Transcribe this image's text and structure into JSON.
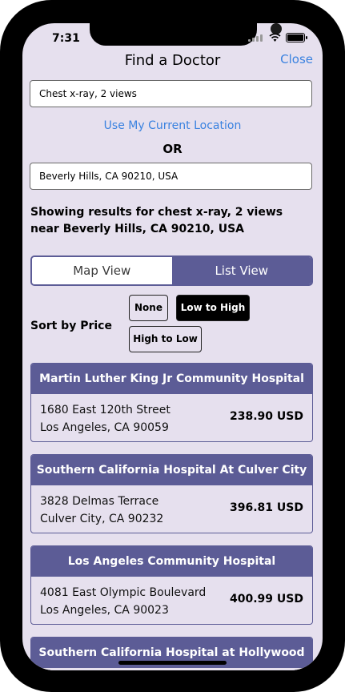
{
  "status": {
    "time": "7:31"
  },
  "header": {
    "title": "Find a Doctor",
    "close_label": "Close"
  },
  "search": {
    "procedure_value": "Chest x-ray, 2 views",
    "location_link": "Use My Current Location",
    "or_label": "OR",
    "location_value": "Beverly Hills, CA 90210, USA"
  },
  "results_text": "Showing results for chest x-ray, 2 views near Beverly Hills, CA 90210, USA",
  "view_toggle": {
    "map_label": "Map View",
    "list_label": "List View",
    "selected": "List View"
  },
  "sort": {
    "label": "Sort by Price",
    "options": [
      "None",
      "Low to High",
      "High to Low"
    ],
    "selected": "Low to High"
  },
  "hospitals": [
    {
      "name": "Martin Luther King Jr Community Hospital",
      "address1": "1680 East 120th Street",
      "address2": "Los Angeles, CA 90059",
      "price": "238.90 USD"
    },
    {
      "name": "Southern California Hospital At Culver City",
      "address1": "3828 Delmas Terrace",
      "address2": "Culver City, CA 90232",
      "price": "396.81 USD"
    },
    {
      "name": "Los Angeles Community Hospital",
      "address1": "4081 East Olympic Boulevard",
      "address2": "Los Angeles, CA 90023",
      "price": "400.99 USD"
    },
    {
      "name": "Southern California Hospital at Hollywood",
      "address1": "",
      "address2": "",
      "price": ""
    }
  ],
  "colors": {
    "accent": "#5c5c96",
    "background": "#e6e0ee",
    "link": "#3a82e0"
  }
}
